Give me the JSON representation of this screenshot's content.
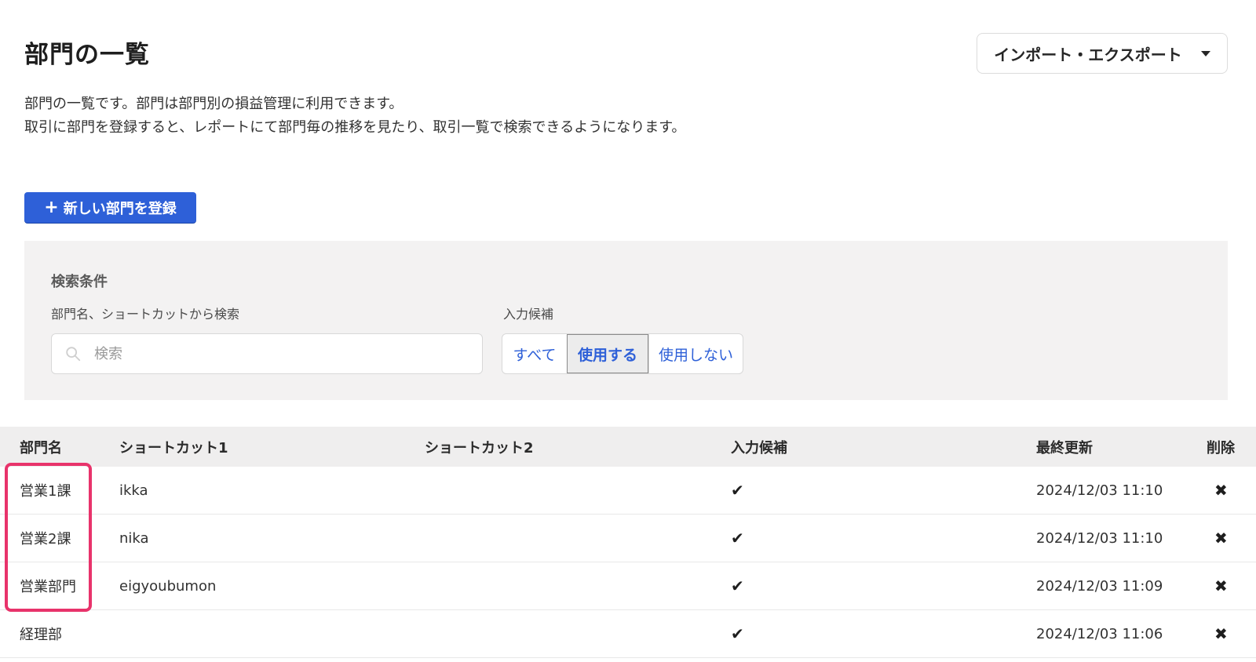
{
  "page": {
    "title": "部門の一覧",
    "description_line1": "部門の一覧です。部門は部門別の損益管理に利用できます。",
    "description_line2": "取引に部門を登録すると、レポートにて部門毎の推移を見たり、取引一覧で検索できるようになります。"
  },
  "header": {
    "import_export_label": "インポート・エクスポート"
  },
  "actions": {
    "new_department_label": "新しい部門を登録"
  },
  "search": {
    "heading": "検索条件",
    "name_label": "部門名、ショートカットから検索",
    "placeholder": "検索",
    "candidate_label": "入力候補",
    "options": [
      "すべて",
      "使用する",
      "使用しない"
    ],
    "selected": "使用する"
  },
  "table": {
    "headers": {
      "name": "部門名",
      "shortcut1": "ショートカット1",
      "shortcut2": "ショートカット2",
      "candidate": "入力候補",
      "updated": "最終更新",
      "delete": "削除"
    },
    "rows": [
      {
        "name": "営業1課",
        "shortcut1": "ikka",
        "shortcut2": "",
        "candidate": "✔",
        "updated": "2024/12/03 11:10",
        "delete": "✖"
      },
      {
        "name": "営業2課",
        "shortcut1": "nika",
        "shortcut2": "",
        "candidate": "✔",
        "updated": "2024/12/03 11:10",
        "delete": "✖"
      },
      {
        "name": "営業部門",
        "shortcut1": "eigyoubumon",
        "shortcut2": "",
        "candidate": "✔",
        "updated": "2024/12/03 11:09",
        "delete": "✖"
      },
      {
        "name": "経理部",
        "shortcut1": "",
        "shortcut2": "",
        "candidate": "✔",
        "updated": "2024/12/03 11:06",
        "delete": "✖"
      }
    ]
  },
  "colors": {
    "primary": "#2e60d8",
    "highlight": "#e8336b",
    "panel_bg": "#f3f2f2"
  }
}
